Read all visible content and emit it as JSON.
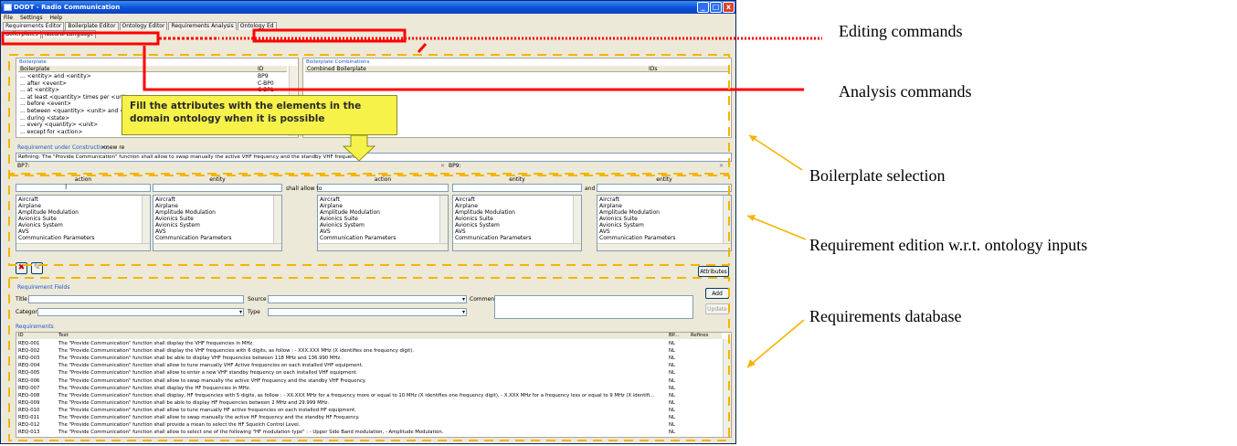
{
  "window": {
    "title": "DODT - Radio Communication",
    "min": "_",
    "max": "□",
    "close": "x"
  },
  "menu": [
    "File",
    "Settings",
    "Help"
  ],
  "main_tabs": [
    "Requirements Editor",
    "Boilerplate Editor",
    "Ontology Editor",
    "Requirements Analysis",
    "Ontology Ed"
  ],
  "sub_tabs": [
    "Boilerplates",
    "Natural Language"
  ],
  "boilerplate": {
    "title": "Boilerplate",
    "col_name": "Boilerplate",
    "col_id": "ID",
    "rows": [
      {
        "text": "... <entity> and <entity>",
        "id": "BP9"
      },
      {
        "text": "... after <event>",
        "id": "C-BP0"
      },
      {
        "text": "... at <entity>",
        "id": "C-BP1"
      },
      {
        "text": "... at least <quantity> times per <unit>",
        "id": ""
      },
      {
        "text": "... before <event>",
        "id": ""
      },
      {
        "text": "... between <quantity> <unit> and <quantity>",
        "id": ""
      },
      {
        "text": "... during <state>",
        "id": ""
      },
      {
        "text": "... every <quantity> <unit>",
        "id": ""
      },
      {
        "text": "... except for <action>",
        "id": ""
      }
    ]
  },
  "combinations": {
    "title": "Boilerplate Combinations",
    "col_name": "Combined Boilerplate",
    "col_ids": "IDs"
  },
  "construction": {
    "label": "Requirement under Construction:",
    "value": "<new re",
    "refining": "Refining: The \"Provide Communication\" function shall allow to swap manually the active VHF frequency and the standby VHF frequency.",
    "bp7": "BP7:",
    "bp9": "BP9:",
    "close_left": "✕",
    "close_right": "✕"
  },
  "inputs": {
    "headers": [
      "action",
      "entity",
      "action",
      "entity",
      "entity"
    ],
    "shall_allow_to": "shall allow to",
    "and": "and",
    "cursor": "I",
    "list_items": [
      "Aircraft",
      "Airplane",
      "Amplitude Modulation",
      "Avionics Suite",
      "Avionics System",
      "AVS",
      "Communication Parameters"
    ]
  },
  "icons": {
    "delete": "✖",
    "edit": "✎"
  },
  "attributes_button": "Attributes",
  "fields": {
    "title": "Requirement Fields",
    "title_label": "Title",
    "source_label": "Source",
    "comment_label": "Comment",
    "category_label": "Category",
    "type_label": "Type",
    "add_button": "Add",
    "update_button": "Update",
    "dropdown": "▾"
  },
  "requirements": {
    "title": "Requirements",
    "col_id": "ID",
    "col_text": "Text",
    "col_bp": "BP...",
    "col_refines": "Refines",
    "rows": [
      {
        "id": "REQ-001",
        "text": "The \"Provide Communication\" function shall display the VHF frequencies in MHz.",
        "bp": "NL"
      },
      {
        "id": "REQ-002",
        "text": "The \"Provide Communication\" function shall display the VHF frequencies with 6 digits, as follow : - XXX.XXX MHz (X identifies one frequency digit).",
        "bp": "NL"
      },
      {
        "id": "REQ-003",
        "text": "The \"Provide Communication\" function shall be able to display VHF frequencies between 118 MHz and 136.990 MHz.",
        "bp": "NL"
      },
      {
        "id": "REQ-004",
        "text": "The \"Provide Communication\" function shall allow to tune manually VHF Active frequencies on each installed VHF equipment.",
        "bp": "NL"
      },
      {
        "id": "REQ-005",
        "text": "The \"Provide Communication\" function shall allow to enter a new VHF standby frequency on each installed VHF equipment.",
        "bp": "NL"
      },
      {
        "id": "REQ-006",
        "text": "The \"Provide Communication\" function shall allow to swap manually the active VHF frequency and the standby VHF Frequency.",
        "bp": "NL"
      },
      {
        "id": "REQ-007",
        "text": "The \"Provide Communication\" function shall display the HF frequencies in MHz.",
        "bp": "NL"
      },
      {
        "id": "REQ-008",
        "text": "The \"Provide Communication\" function shall display, HF frequencies with 5 digits, as follow : - XX.XXX MHz for a frequency more or equal to 10 MHz (X identifies one frequency digit), - X.XXX MHz for a frequency less or equal to 9 MHz (X identifi...",
        "bp": "NL"
      },
      {
        "id": "REQ-009",
        "text": "The \"Provide Communication\" function shall be able to display HF frequencies between 2 MHz and 29.999 MHz.",
        "bp": "NL"
      },
      {
        "id": "REQ-010",
        "text": "The \"Provide Communication\" function shall allow to tune manually HF active frequencies on each installed HF equipment.",
        "bp": "NL"
      },
      {
        "id": "REQ-011",
        "text": "The \"Provide Communication\" function shall allow to swap manually the active HF frequency and the standby HF Frequency.",
        "bp": "NL"
      },
      {
        "id": "REQ-012",
        "text": "The \"Provide Communication\" function shall provide a mean to select the HF Squelch Control Level.",
        "bp": "NL"
      },
      {
        "id": "REQ-013",
        "text": "The \"Provide Communication\" function shall allow to select one of the following \"HF modulation type\" : - Upper Side Band modulation, - Amplitude Modulation.",
        "bp": "NL"
      }
    ]
  },
  "callout": "Fill the attributes with the elements in the domain ontology when it is possible",
  "annotations": [
    "Editing commands",
    "Analysis commands",
    "Boilerplate selection",
    "Requirement edition w.r.t. ontology inputs",
    "Requirements database"
  ],
  "colors": {
    "red": "#ff0000",
    "orange": "#f5b400",
    "callout": "#f6f24a",
    "titlebar": "#0a4ed8"
  }
}
